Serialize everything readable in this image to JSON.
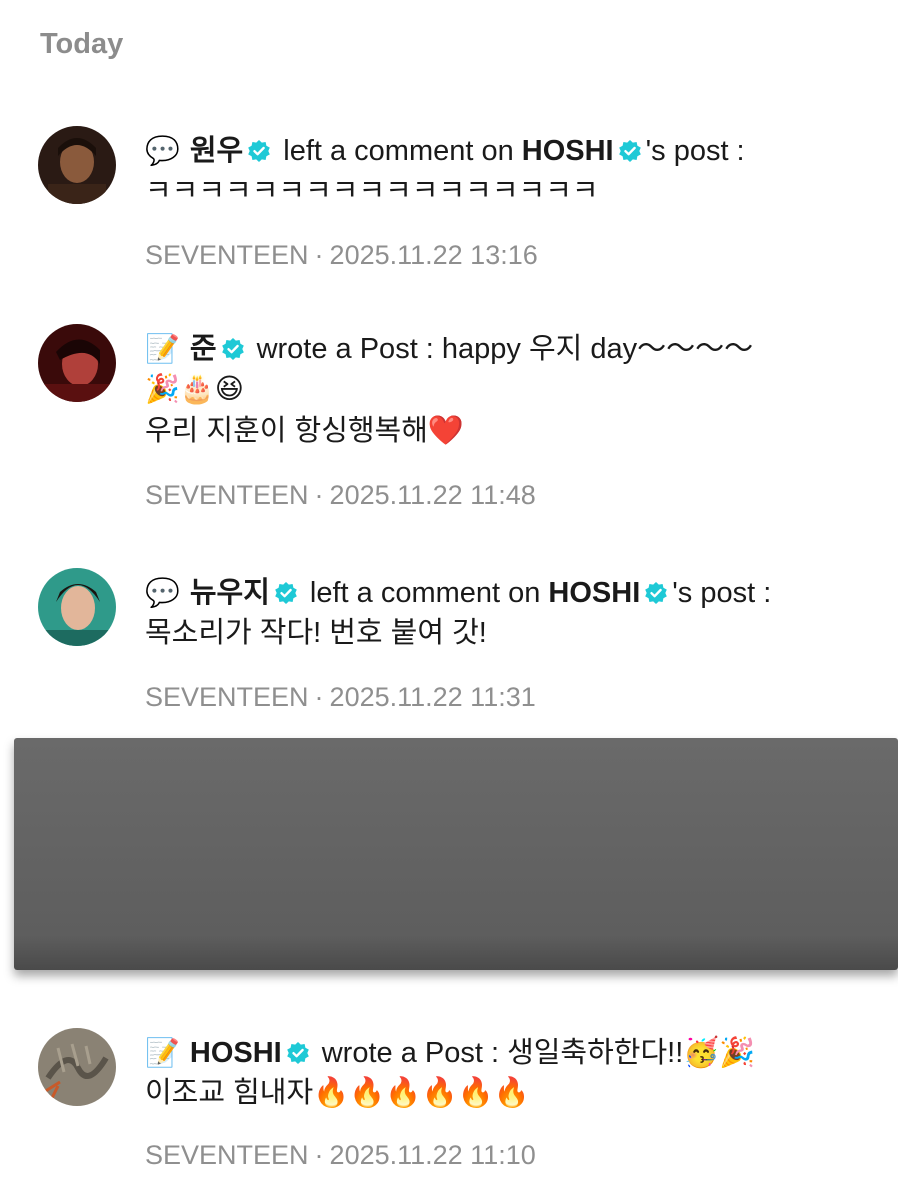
{
  "header": {
    "title": "Today"
  },
  "colors": {
    "verified": "#1ec9d6",
    "meta": "#8f8f8f"
  },
  "notifications": [
    {
      "type_icon": "💬",
      "author": "원우",
      "action": "left a comment on",
      "target": "HOSHI",
      "suffix": "'s post :",
      "body": [
        "ㅋㅋㅋㅋㅋㅋㅋㅋㅋㅋㅋㅋㅋㅋㅋㅋㅋ"
      ],
      "group": "SEVENTEEN",
      "sep": "·",
      "time": "2025.11.22 13:16"
    },
    {
      "type_icon": "📝",
      "author": "준",
      "action": "wrote a Post : happy 우지 day～～～～",
      "body": [
        "🎉🎂😆",
        "우리 지훈이 항싱행복해❤️"
      ],
      "group": "SEVENTEEN",
      "sep": "·",
      "time": "2025.11.22 11:48"
    },
    {
      "type_icon": "💬",
      "author": "뉴우지",
      "action": "left a comment on",
      "target": "HOSHI",
      "suffix": "'s post :",
      "body": [
        "목소리가 작다! 번호 붙여 갓!"
      ],
      "group": "SEVENTEEN",
      "sep": "·",
      "time": "2025.11.22 11:31"
    },
    {
      "type_icon": "📝",
      "author": "HOSHI",
      "action": "wrote a Post : 생일축하한다!!🥳🎉",
      "body": [
        "이조교 힘내자🔥🔥🔥🔥🔥🔥"
      ],
      "group": "SEVENTEEN",
      "sep": "·",
      "time": "2025.11.22 11:10"
    }
  ]
}
